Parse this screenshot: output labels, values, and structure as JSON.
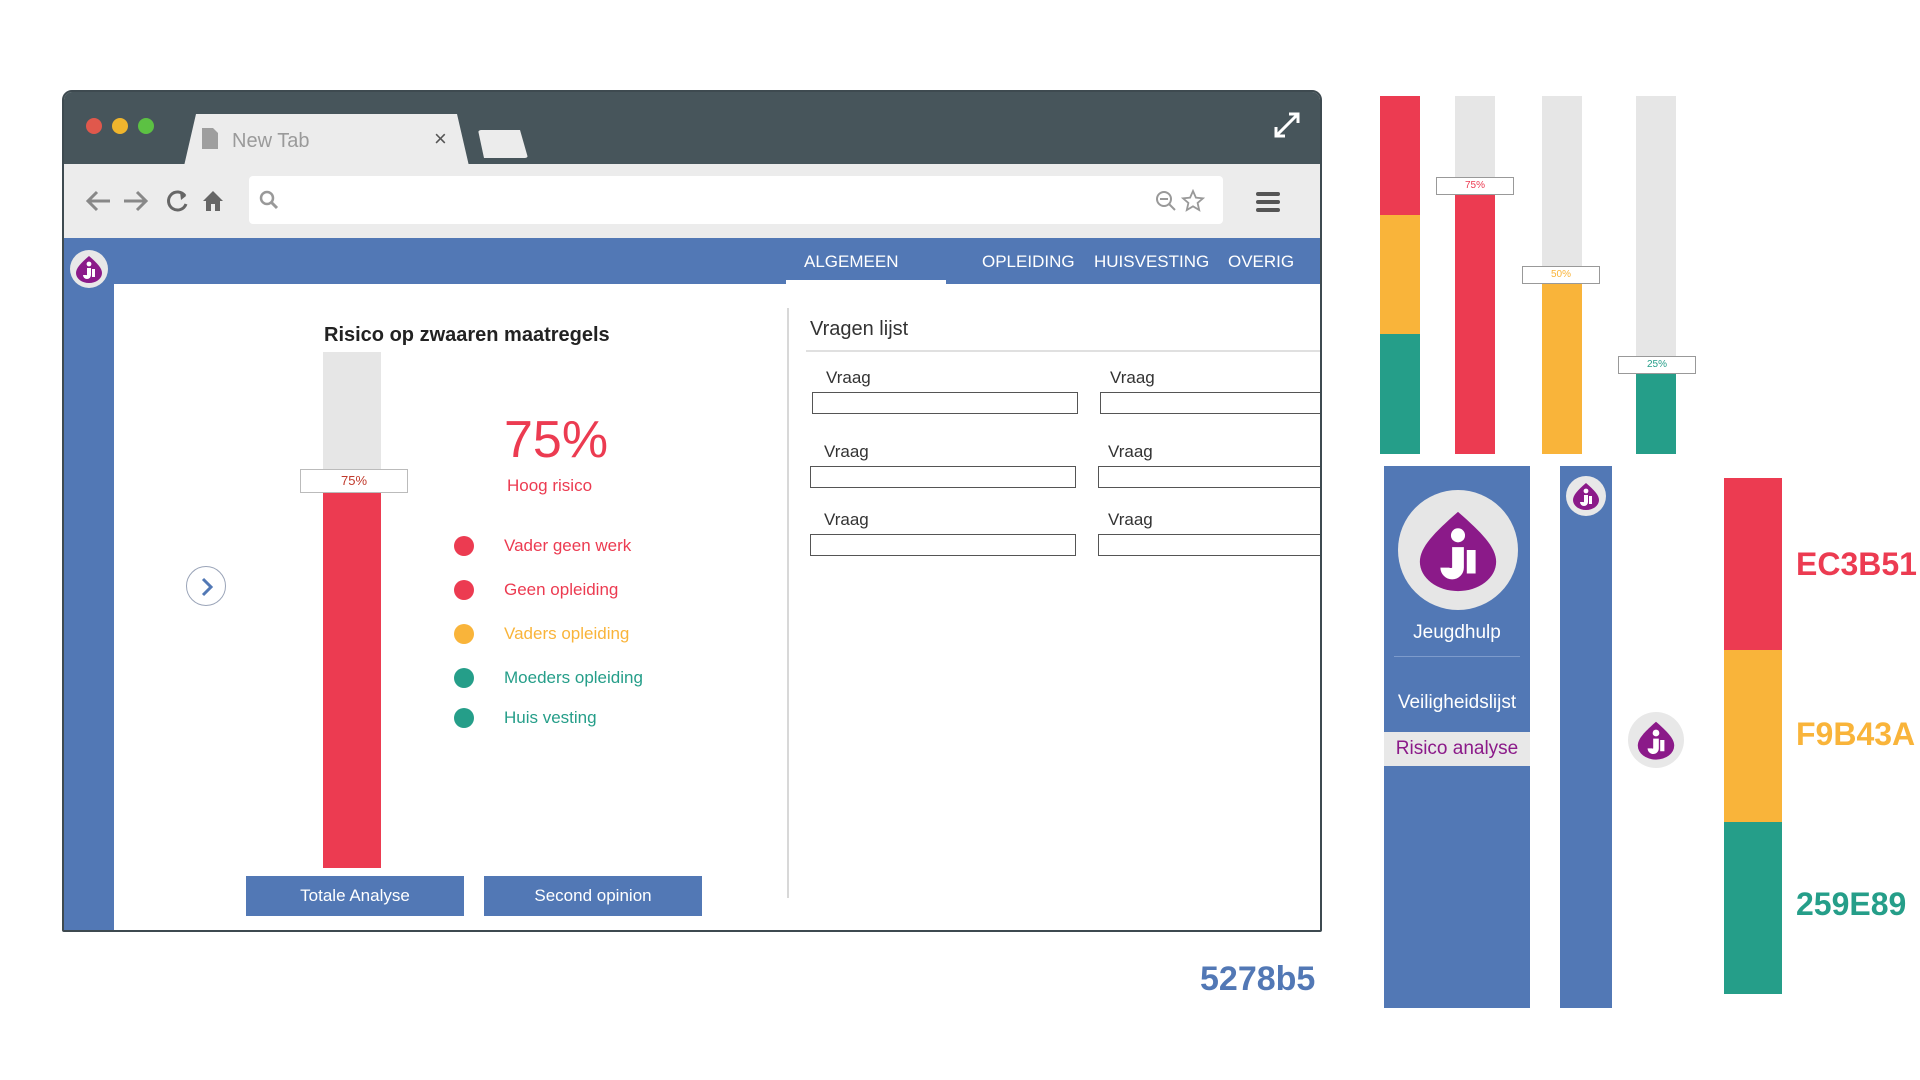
{
  "browser": {
    "tab_title": "New Tab",
    "tab_close": "×",
    "url_placeholder": "",
    "icons": [
      "back-arrow-icon",
      "forward-arrow-icon",
      "reload-icon",
      "home-icon",
      "search-icon",
      "zoom-out-icon",
      "star-icon",
      "menu-icon",
      "fullscreen-icon",
      "page-icon"
    ]
  },
  "nav": {
    "tabs": [
      "ALGEMEEN",
      "OPLEIDING",
      "HUISVESTING",
      "OVERIG"
    ],
    "active": "ALGEMEEN"
  },
  "risk": {
    "title": "Risico op zwaaren maatregels",
    "percent_value": 0.75,
    "bar_label": "75%",
    "percent_text": "75%",
    "level": "Hoog risico",
    "legend": [
      {
        "label": "Vader geen werk",
        "color": "#EC3B51"
      },
      {
        "label": "Geen opleiding",
        "color": "#EC3B51"
      },
      {
        "label": "Vaders opleiding",
        "color": "#F9B43A"
      },
      {
        "label": "Moeders opleiding",
        "color": "#259E89"
      },
      {
        "label": "Huis vesting",
        "color": "#259E89"
      }
    ],
    "buttons": {
      "total": "Totale Analyse",
      "second": "Second opinion"
    }
  },
  "questions": {
    "title": "Vragen lijst",
    "items": [
      {
        "label": "Vraag",
        "value": ""
      },
      {
        "label": "Vraag",
        "value": ""
      },
      {
        "label": "Vraag",
        "value": ""
      },
      {
        "label": "Vraag",
        "value": ""
      },
      {
        "label": "Vraag",
        "value": ""
      },
      {
        "label": "Vraag",
        "value": ""
      }
    ]
  },
  "assets": {
    "bars": [
      {
        "fill": 0.75,
        "label": "75%",
        "color": "#EC3B51"
      },
      {
        "fill": 0.5,
        "label": "50%",
        "color": "#F9B43A"
      },
      {
        "fill": 0.25,
        "label": "25%",
        "color": "#259E89"
      }
    ],
    "sidebar": {
      "name": "Jeugdhulp",
      "menu1": "Veiligheidslijst",
      "menu2": "Risico analyse"
    },
    "primary_hex": "5278b5",
    "palette": [
      {
        "hex": "EC3B51",
        "color": "#EC3B51"
      },
      {
        "hex": "F9B43A",
        "color": "#F9B43A"
      },
      {
        "hex": "259E89",
        "color": "#259E89"
      }
    ]
  }
}
